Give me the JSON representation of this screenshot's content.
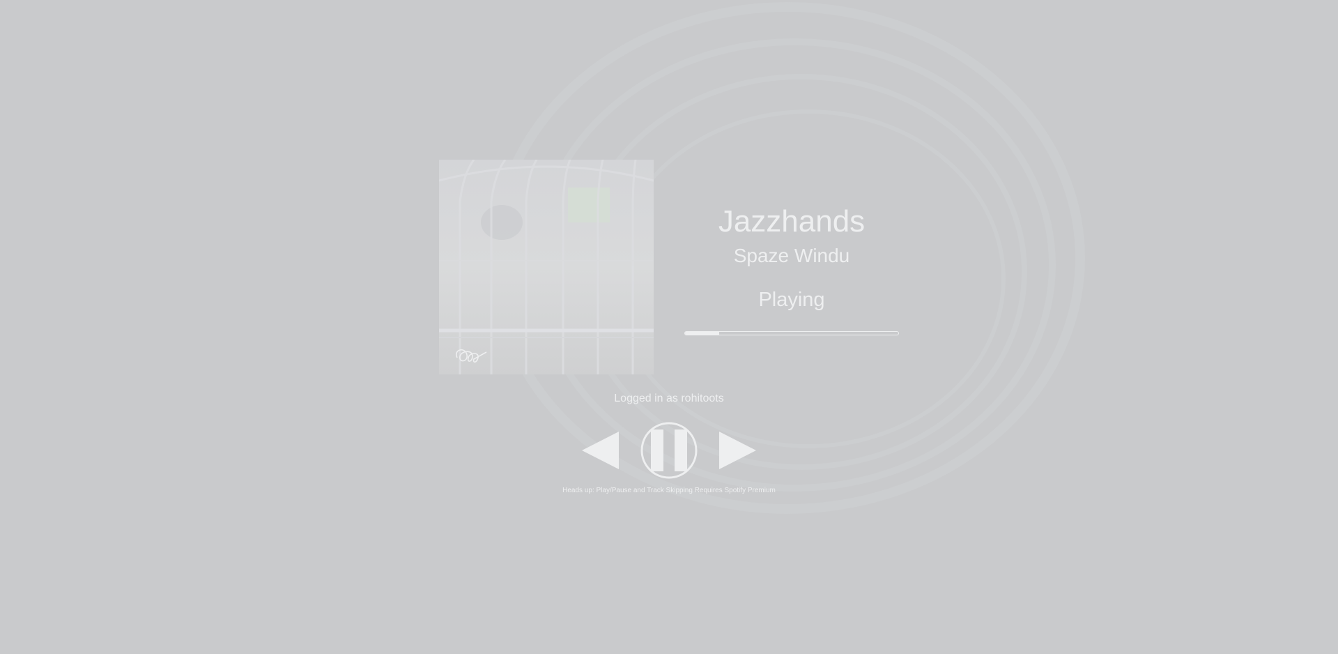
{
  "track": {
    "title": "Jazzhands",
    "artist": "Spaze Windu",
    "status": "Playing",
    "progress": 0.16
  },
  "account": {
    "login_text": "Logged in as rohitoots"
  },
  "controls": {
    "prev_icon": "previous-track-icon",
    "play_pause_icon": "pause-icon",
    "next_icon": "next-track-icon"
  },
  "note": {
    "text": "Heads up: Play/Pause and Track Skipping Requires Spotify Premium"
  },
  "colors": {
    "background": "#c9cacc",
    "foreground": "#eeeff0"
  }
}
